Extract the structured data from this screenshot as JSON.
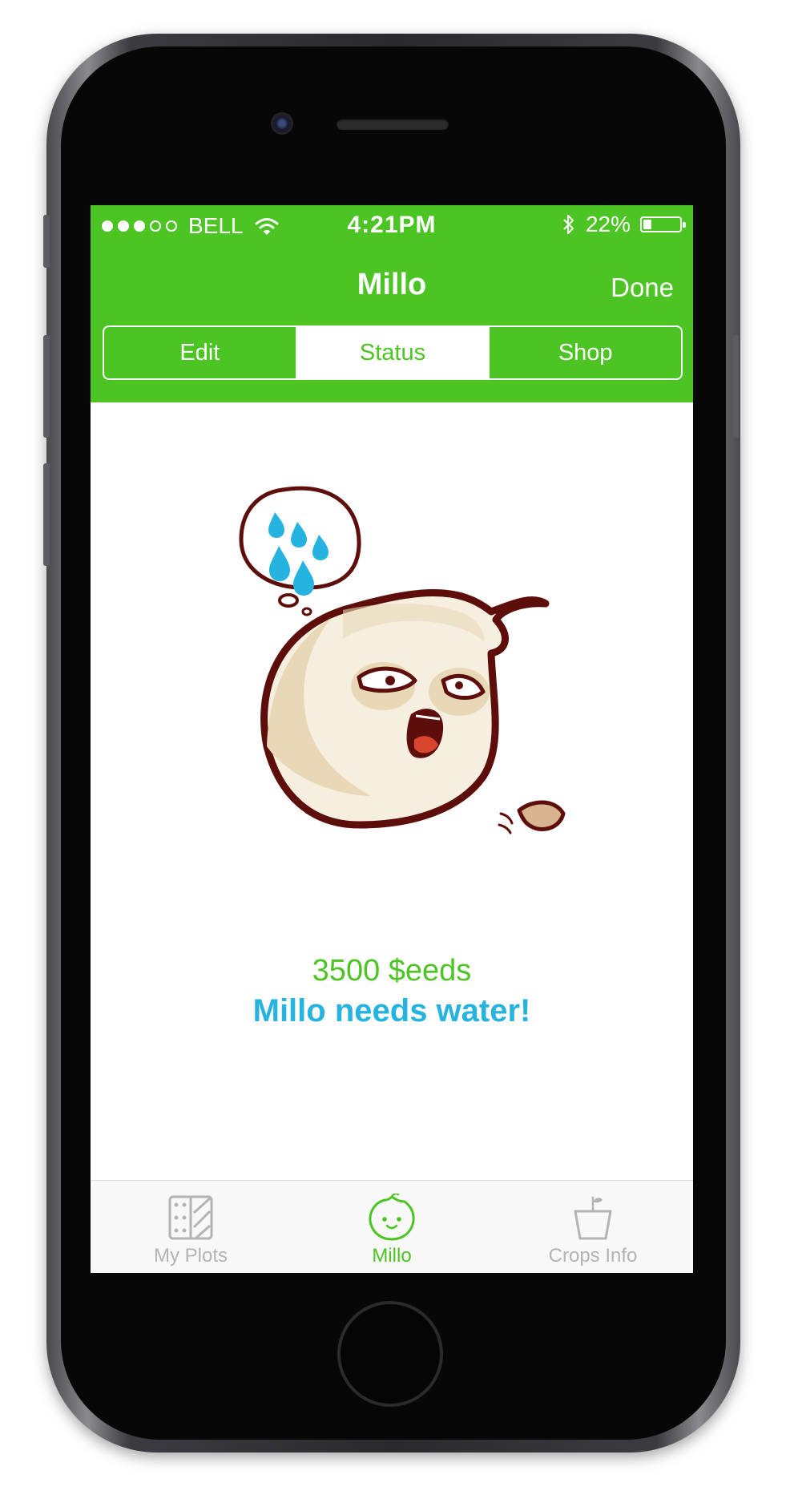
{
  "status_bar": {
    "carrier": "BELL",
    "time": "4:21PM",
    "battery": "22%",
    "battery_level": 0.22,
    "signal_bars": 3
  },
  "nav": {
    "title": "Millo",
    "done_label": "Done"
  },
  "segments": [
    {
      "label": "Edit"
    },
    {
      "label": "Status"
    },
    {
      "label": "Shop"
    }
  ],
  "active_segment": "Status",
  "plant": {
    "price": "3500 $eeds",
    "message": "Millo needs water!"
  },
  "tabs": [
    {
      "label": "My Plots",
      "icon": "plots-icon"
    },
    {
      "label": "Millo",
      "icon": "millo-face-icon"
    },
    {
      "label": "Crops Info",
      "icon": "cup-sprout-icon"
    }
  ],
  "active_tab": "Millo",
  "colors": {
    "brand_green": "#4cc424",
    "alert_blue": "#26b3e0",
    "inactive_gray": "#b3b3b3",
    "outline_brown": "#5e0e0a"
  }
}
